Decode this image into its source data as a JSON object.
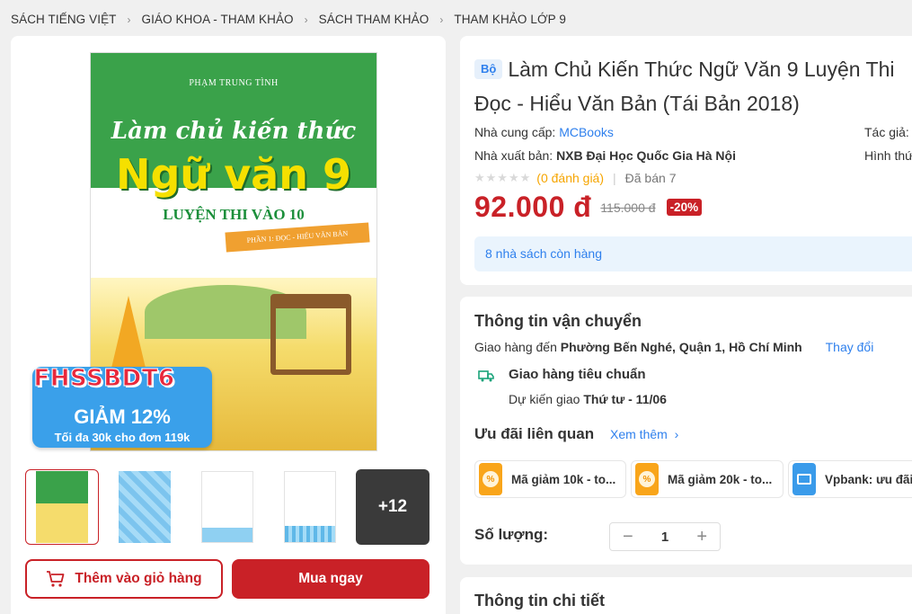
{
  "breadcrumb": [
    "SÁCH TIẾNG VIỆT",
    "GIÁO KHOA - THAM KHẢO",
    "SÁCH THAM KHẢO",
    "THAM KHẢO LỚP 9"
  ],
  "cover": {
    "author": "PHẠM TRUNG TÌNH",
    "title_line1": "Làm chủ kiến thức",
    "title_line2": "Ngữ văn 9",
    "title_line3": "LUYỆN THI VÀO 10",
    "ribbon": "PHẦN 1: ĐỌC - HIỂU VĂN BẢN",
    "promo_code": "FHSSBDT6",
    "promo_line1": "GIẢM 12%",
    "promo_line2": "Tối đa 30k cho đơn 119k"
  },
  "thumbnails": {
    "more_label": "+12"
  },
  "actions": {
    "add_to_cart": "Thêm vào giỏ hàng",
    "buy_now": "Mua ngay"
  },
  "product": {
    "badge": "Bộ",
    "title": "Làm Chủ Kiến Thức Ngữ Văn 9 Luyện Thi Đọc - Hiểu Văn Bản (Tái Bản 2018)",
    "supplier_label": "Nhà cung cấp:",
    "supplier": "MCBooks",
    "author_label": "Tác giả:",
    "publisher_label": "Nhà xuất bản:",
    "publisher": "NXB Đại Học Quốc Gia Hà Nội",
    "format_label": "Hình thức",
    "rating_text": "(0 đánh giá)",
    "sold_label": "Đã bán",
    "sold_count": "7",
    "price": "92.000 đ",
    "old_price": "115.000 đ",
    "discount": "-20%",
    "stock": "8 nhà sách còn hàng",
    "rating_stars": 0
  },
  "shipping": {
    "heading": "Thông tin vận chuyển",
    "deliver_to_label": "Giao hàng đến",
    "address": "Phường Bến Nghé, Quận 1, Hồ Chí Minh",
    "change": "Thay đổi",
    "method": "Giao hàng tiêu chuẩn",
    "eta_label": "Dự kiến giao",
    "eta": "Thứ tư - 11/06"
  },
  "offers": {
    "heading": "Ưu đãi liên quan",
    "see_more": "Xem thêm",
    "items": [
      {
        "label": "Mã giảm 10k - to..."
      },
      {
        "label": "Mã giảm 20k - to..."
      },
      {
        "label": "Vpbank: ưu đãi"
      }
    ]
  },
  "quantity": {
    "label": "Số lượng:",
    "value": "1",
    "minus": "−",
    "plus": "+"
  },
  "details": {
    "heading": "Thông tin chi tiết"
  },
  "colors": {
    "brand_red": "#c92127",
    "link_blue": "#2f80ed",
    "star_orange": "#f6a500"
  }
}
